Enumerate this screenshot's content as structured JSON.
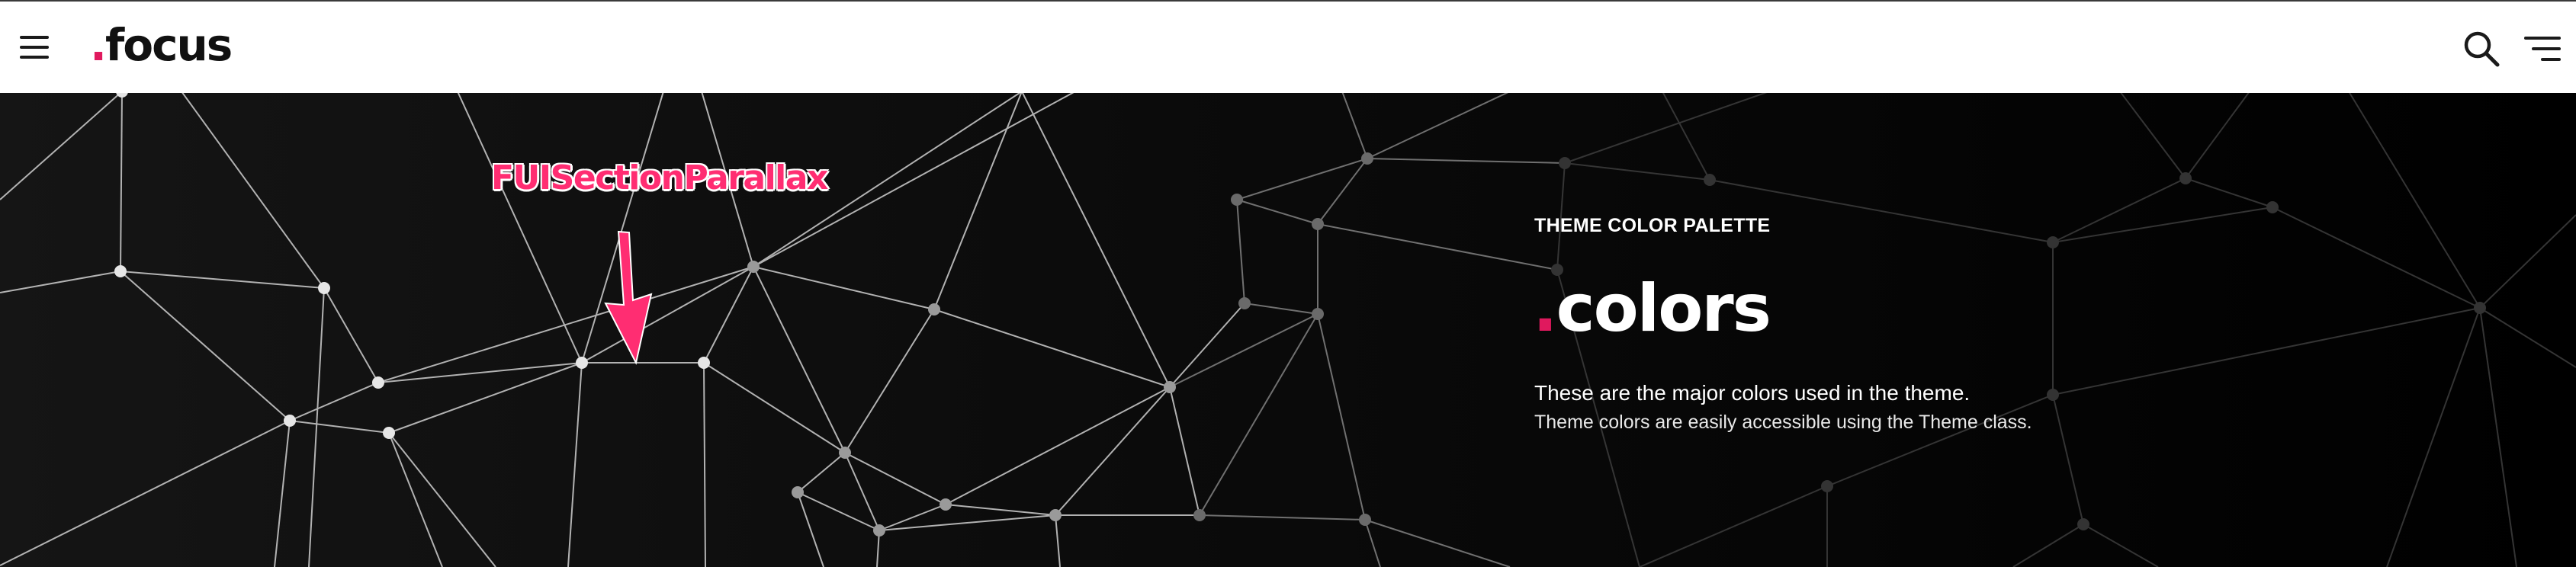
{
  "header": {
    "logo_dot": ".",
    "logo_text": "focus",
    "menu_icon": "hamburger-menu-icon",
    "search_icon": "search-icon",
    "filter_icon": "filter-lines-icon"
  },
  "hero": {
    "eyebrow": "THEME COLOR PALETTE",
    "title_dot": ".",
    "title_text": "colors",
    "lead": "These are the major colors used in the theme.",
    "sub": "Theme colors are easily accessible using the Theme class."
  },
  "annotation": {
    "label": "FUISectionParallax",
    "color": "#ff2d72"
  },
  "colors": {
    "accent": "#e0195e",
    "header_bg": "#ffffff",
    "hero_bg": "#000000"
  }
}
